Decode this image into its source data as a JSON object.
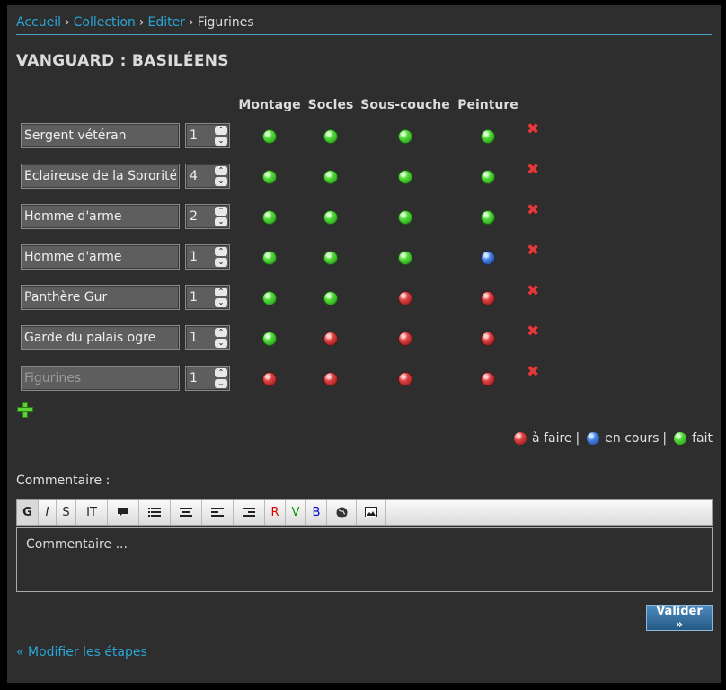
{
  "breadcrumb": {
    "items": [
      "Accueil",
      "Collection",
      "Editer"
    ],
    "current": "Figurines",
    "separator": "›"
  },
  "page_title": "VANGUARD : BASILÉENS",
  "columns": [
    "Montage",
    "Socles",
    "Sous-couche",
    "Peinture"
  ],
  "rows": [
    {
      "name": "Sergent vétéran",
      "qty": "1",
      "status": [
        "fait",
        "fait",
        "fait",
        "fait"
      ]
    },
    {
      "name": "Eclaireuse de la Sororité",
      "qty": "4",
      "status": [
        "fait",
        "fait",
        "fait",
        "fait"
      ]
    },
    {
      "name": "Homme d'arme",
      "qty": "2",
      "status": [
        "fait",
        "fait",
        "fait",
        "fait"
      ]
    },
    {
      "name": "Homme d'arme",
      "qty": "1",
      "status": [
        "fait",
        "fait",
        "fait",
        "en cours"
      ]
    },
    {
      "name": "Panthère Gur",
      "qty": "1",
      "status": [
        "fait",
        "fait",
        "à faire",
        "à faire"
      ]
    },
    {
      "name": "Garde du palais ogre",
      "qty": "1",
      "status": [
        "fait",
        "à faire",
        "à faire",
        "à faire"
      ]
    },
    {
      "name": "",
      "placeholder": "Figurines",
      "qty": "1",
      "status": [
        "à faire",
        "à faire",
        "à faire",
        "à faire"
      ]
    }
  ],
  "legend": {
    "todo": "à faire",
    "in_progress": "en cours",
    "done": "fait",
    "separator": "|"
  },
  "status_colors": {
    "à faire": "#e24545",
    "en cours": "#4a86e8",
    "fait": "#55dd3a"
  },
  "comment": {
    "label": "Commentaire :",
    "placeholder": "Commentaire ..."
  },
  "toolbar": {
    "buttons": [
      {
        "id": "bold",
        "label": "G"
      },
      {
        "id": "italic",
        "label": "I"
      },
      {
        "id": "strike",
        "label": "S"
      },
      {
        "id": "font-size",
        "label": "IT"
      },
      {
        "id": "quote",
        "icon": "speech-bubble-icon"
      },
      {
        "id": "list",
        "icon": "list-icon"
      },
      {
        "id": "align-center",
        "icon": "align-center-icon"
      },
      {
        "id": "align-left",
        "icon": "align-left-icon"
      },
      {
        "id": "align-right",
        "icon": "align-right-icon"
      },
      {
        "id": "red",
        "label": "R",
        "color": "#e00000"
      },
      {
        "id": "green",
        "label": "V",
        "color": "#009900"
      },
      {
        "id": "blue",
        "label": "B",
        "color": "#0000dd"
      },
      {
        "id": "link",
        "icon": "globe-icon"
      },
      {
        "id": "image",
        "icon": "image-icon"
      }
    ]
  },
  "submit_label": "Valider »",
  "back_link": "« Modifier les étapes"
}
